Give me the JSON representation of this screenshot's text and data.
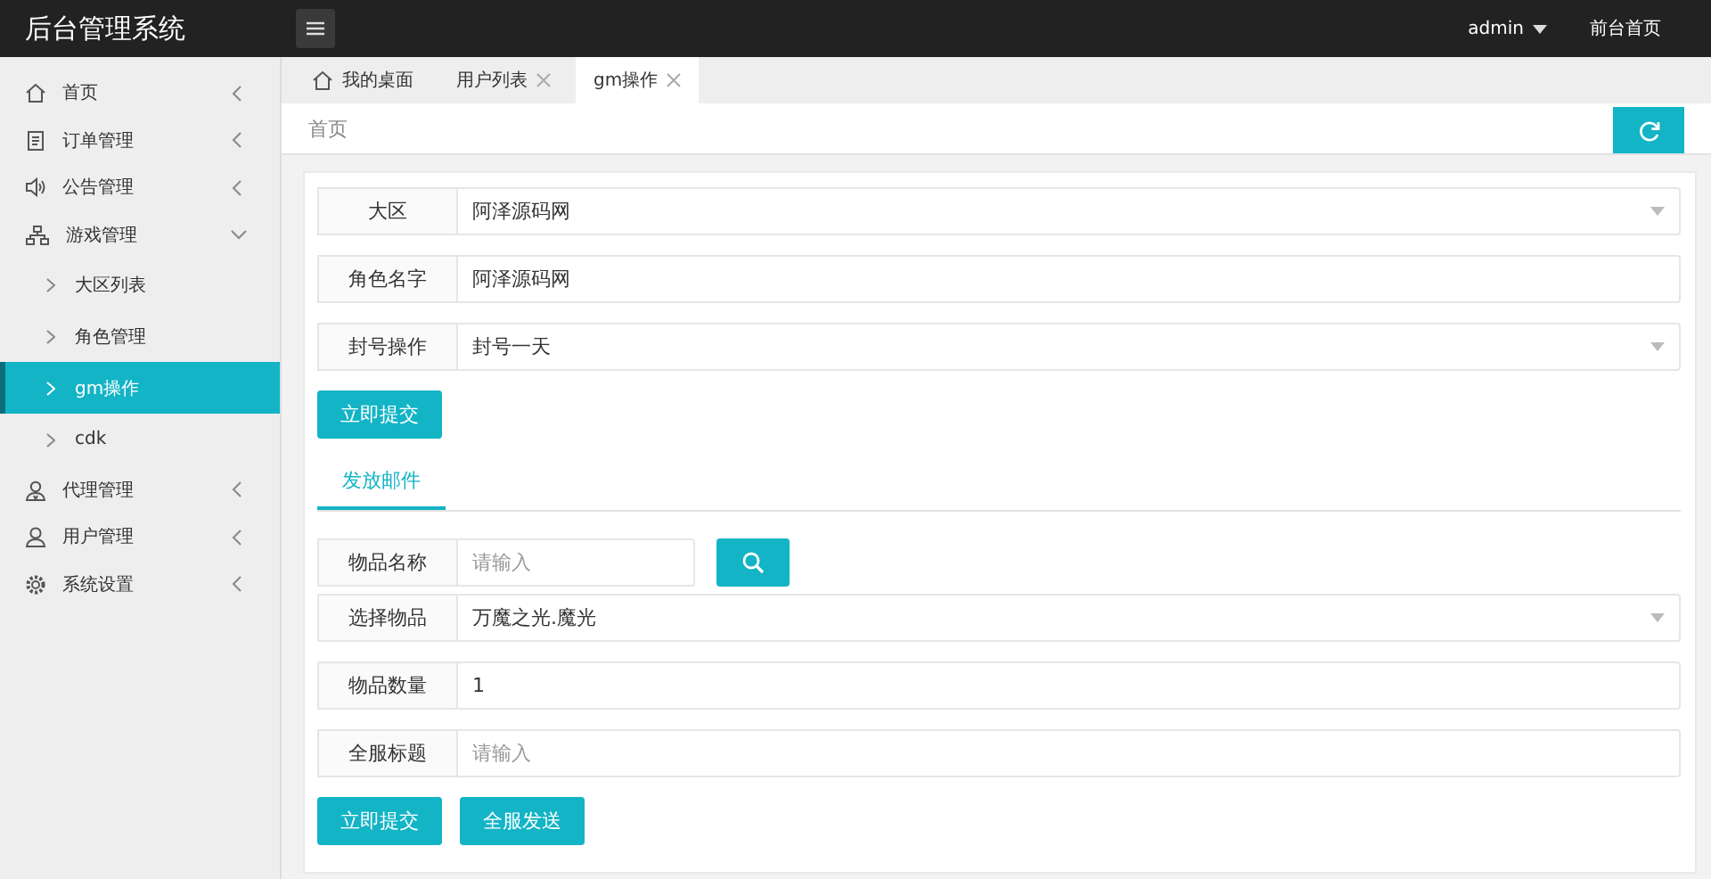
{
  "header": {
    "title": "后台管理系统",
    "user": "admin",
    "home_link": "前台首页"
  },
  "sidebar": {
    "items": [
      {
        "label": "首页",
        "expanded": false
      },
      {
        "label": "订单管理",
        "expanded": false
      },
      {
        "label": "公告管理",
        "expanded": false
      },
      {
        "label": "游戏管理",
        "expanded": true,
        "children": [
          {
            "label": "大区列表",
            "selected": false
          },
          {
            "label": "角色管理",
            "selected": false
          },
          {
            "label": "gm操作",
            "selected": true
          },
          {
            "label": "cdk",
            "selected": false
          }
        ]
      },
      {
        "label": "代理管理",
        "expanded": false
      },
      {
        "label": "用户管理",
        "expanded": false
      },
      {
        "label": "系统设置",
        "expanded": false
      }
    ]
  },
  "tabs": [
    {
      "label": "我的桌面",
      "closable": false,
      "selected": false
    },
    {
      "label": "用户列表",
      "closable": true,
      "selected": false
    },
    {
      "label": "gm操作",
      "closable": true,
      "selected": true
    }
  ],
  "breadcrumb": "首页",
  "ban_form": {
    "fields": [
      {
        "label": "大区",
        "kind": "select",
        "value": "阿泽源码网"
      },
      {
        "label": "角色名字",
        "kind": "text",
        "value": "阿泽源码网"
      },
      {
        "label": "封号操作",
        "kind": "select",
        "value": "封号一天"
      }
    ],
    "buttons": [
      "立即提交"
    ]
  },
  "mail_tabs": [
    {
      "label": "发放邮件",
      "selected": true
    }
  ],
  "mail_form": {
    "fields": [
      {
        "label": "物品名称",
        "kind": "search",
        "placeholder": "请输入"
      },
      {
        "label": "选择物品",
        "kind": "select",
        "value": "万魔之光.魔光"
      },
      {
        "label": "物品数量",
        "kind": "text",
        "value": "1"
      },
      {
        "label": "全服标题",
        "kind": "text",
        "placeholder": "请输入"
      }
    ],
    "buttons": [
      "立即提交",
      "全服发送"
    ]
  }
}
